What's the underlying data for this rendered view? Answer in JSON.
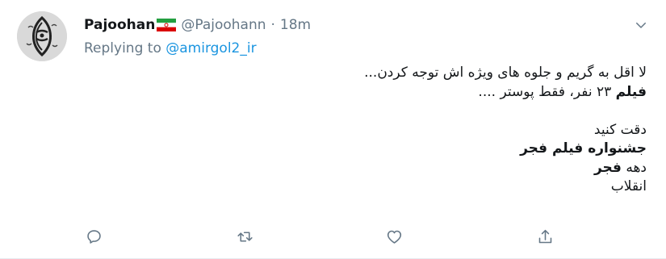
{
  "tweet": {
    "display_name": "Pajoohan",
    "flag_icon": "iran-flag-icon",
    "handle": "@Pajoohann",
    "separator": "·",
    "time": "18m",
    "replying_prefix": "Replying to ",
    "replying_mention": "@amirgol2_ir",
    "body": {
      "line1": "لا اقل به گریم و جلوه های ویژه اش توجه کردن...",
      "line2_bold": "فیلم",
      "line2_rest": " ۲۳ نفر، فقط پوستر ....",
      "line3": "دقت کنید",
      "line4_bold": "جشنواره فیلم فجر",
      "line5_rest": "دهه ",
      "line5_bold": "فجر",
      "line6": "انقلاب"
    }
  },
  "actions": {
    "reply_icon": "reply-icon",
    "retweet_icon": "retweet-icon",
    "like_icon": "heart-icon",
    "share_icon": "share-icon",
    "more_icon": "chevron-down-icon"
  },
  "colors": {
    "text": "#14171a",
    "secondary": "#657786",
    "link": "#1b95e0"
  }
}
